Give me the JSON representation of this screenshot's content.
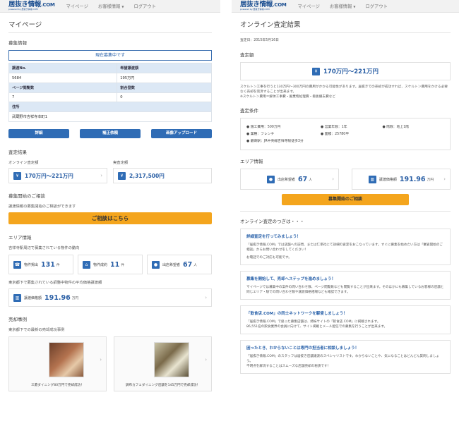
{
  "nav": {
    "logo_main": "居抜き情報",
    "logo_com": ".COM",
    "logo_sub": "powered by 居抜き情報.COM",
    "links": [
      "マイページ",
      "お客様情報",
      "ログアウト"
    ]
  },
  "left": {
    "title": "マイページ",
    "recruit": {
      "title": "募集情報",
      "status": "現在募集中です",
      "headers": [
        "譲渡No.",
        "希望譲渡額",
        "ページ閲覧数",
        "割合登数",
        "住所"
      ],
      "values": [
        "5684",
        "195万円",
        "7",
        "0",
        "武蔵野市吉祥寺本町1"
      ],
      "buttons": [
        "詳細",
        "補正依頼",
        "画像アップロード"
      ]
    },
    "assess": {
      "title": "査定結果",
      "online_label": "オンライン査定額",
      "online_value": "170万円～221万円",
      "actual_label": "実査定額",
      "actual_value": "2,317,500円"
    },
    "consult": {
      "title": "募集開始のご相談",
      "desc": "譲渡情報の募集開始のご相談ができます",
      "button": "ご相談はこちら"
    },
    "area": {
      "title": "エリア情報",
      "desc": "吉祥寺駅周辺で募集されている物件の動向",
      "stats": [
        {
          "label": "物件掲出",
          "value": "131",
          "unit": "件"
        },
        {
          "label": "物件成約",
          "value": "11",
          "unit": "件"
        },
        {
          "label": "出店希望者",
          "value": "67",
          "unit": "人"
        }
      ],
      "avg_desc": "東京都下で募集されている調整中物件の平均価格譲渡額",
      "avg_label": "譲渡価格額",
      "avg_value": "191.96",
      "avg_unit": "万円"
    },
    "cases": {
      "title": "売却事例",
      "desc": "東京都下での最新の売却成功事例",
      "items": [
        "三鷹ダイニング80万円で売却成功！",
        "調布カフェダイニング店舗を145万円で売却成功！"
      ]
    }
  },
  "right": {
    "title": "オンライン査定結果",
    "date": "査定日：2015年5月16日",
    "amount": {
      "title": "査定額",
      "value": "170万円～221万円",
      "note1": "スケルトン工事を行うと130万円～300万円の費用がかかる可能性があります。居抜きでの売却が成功すれば、スケルトン費用をかける必要なく売却を完済することが出来ます。",
      "note2": "※スケルトン費用＝解体工事費・廃棄物処理費・看板撤去費など"
    },
    "conditions": {
      "title": "査定条件",
      "items": [
        "● 施工費用：500万円",
        "● 営業年数：1年",
        "● 階数：地上1階",
        "● 業種：フレンチ",
        "● 面積：25780平",
        "",
        "● 最寄駅：JR中央線吉祥寺駅徒歩3分",
        "",
        ""
      ]
    },
    "area": {
      "title": "エリア情報",
      "stat1_label": "出店希望者",
      "stat1_value": "67",
      "stat1_unit": "人",
      "stat2_label": "譲渡価格額",
      "stat2_value": "191.96",
      "stat2_unit": "万円",
      "button": "募集開始のご相談"
    },
    "next": {
      "title": "オンライン査定のつぎは・・・",
      "cards": [
        {
          "title": "詳細査定を行ってみましょう！",
          "body1": "「居抜き情報.COM」では店舗への訪問、または仁単社にて詳細の査定をおこなっています。すぐに募集を始めたい方は「審査開始のご相談」からお問い合わせをしてください！",
          "body2": "お電話でのご対応も可能です。",
          "body3": ""
        },
        {
          "title": "募集を開始して、売却へステップを進めましょう！",
          "body1": "マイページでは募集中の案件の問い合わせ数、ページ閲覧数なども閲覧することが出来ます。そのほかにも募集しているお客様の店舗と同じエリア・駅での問い合わせ数や譲渡価格相場なども確認できます。",
          "body2": "",
          "body3": ""
        },
        {
          "title": "「飲食店.COM」の同士ネットワークを駆使しましょう！",
          "body1": "「居抜き情報.COM」で扱った募集店舗は、姉妹サイトの「飲食店.COM」に掲載されます。",
          "body2": "86,551名の飲食業界の会員に向けて、サイト掲載とメール配信での募集を行うことが出来ます。",
          "body3": ""
        },
        {
          "title": "困ったとき、わからないことは専門の担当者に相談しましょう！",
          "body1": "「居抜き情報.COM」のスタッフは居抜き店舗譲渡のスペシャリストです。わからないことや、気になることはどんどん質問しましょう。",
          "body2": "不明点を解消することはスムーズな店舗売却の秘訣です！",
          "body3": ""
        }
      ]
    }
  },
  "colors": {
    "accent": "#2f6cb5",
    "orange": "#f4a51d",
    "logo": "#1c4f91"
  }
}
